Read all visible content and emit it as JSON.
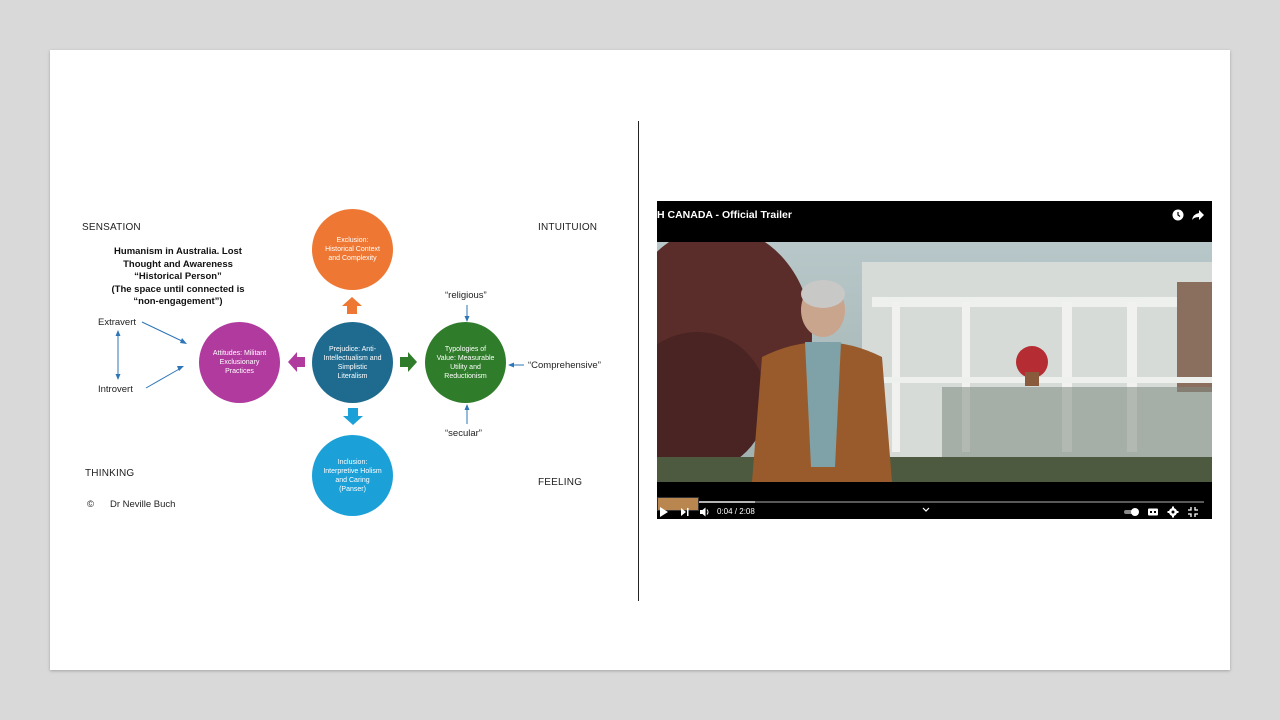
{
  "quadrants": {
    "sensation": "SENSATION",
    "intuition": "INTUITUION",
    "thinking": "THINKING",
    "feeling": "FEELING"
  },
  "caption": {
    "line1": "Humanism in Australia. Lost",
    "line2": "Thought and Awareness",
    "line3": "“Historical Person”",
    "line4": "(The space until connected is",
    "line5": "“non-engagement”)"
  },
  "axis": {
    "extravert": "Extravert",
    "introvert": "Introvert"
  },
  "annotations": {
    "religious": "“religious”",
    "secular": "“secular”",
    "comprehensive": "“Comprehensive”"
  },
  "copyright": {
    "symbol": "©",
    "author": "Dr Neville Buch"
  },
  "circles": {
    "top": {
      "text": "Exclusion: Historical Context and Complexity",
      "color": "#ee7733"
    },
    "left": {
      "text": "Attitudes: Militant Exclusionary Practices",
      "color": "#b03a9e"
    },
    "center": {
      "text": "Prejudice: Anti-Intellectualism and Simplistic Literalism",
      "color": "#1f6b8f"
    },
    "right": {
      "text": "Typologies of Value: Measurable Utility and Reductionism",
      "color": "#2f7d2a"
    },
    "bottom": {
      "text": "Inclusion: Interpretive Holism and Caring (Panser)",
      "color": "#1ba0d8"
    }
  },
  "video": {
    "title": "H CANADA - Official Trailer",
    "time": "0:04 / 2:08",
    "progress": 0.03,
    "buffered": 0.18,
    "icons": {
      "watch_later": "clock-icon",
      "share": "share-icon",
      "play": "play-icon",
      "next": "next-icon",
      "volume": "volume-icon",
      "chevron": "chevron-down-icon",
      "autoplay": "autoplay-toggle-icon",
      "captions": "captions-icon",
      "settings": "gear-icon",
      "fullscreen": "exit-fullscreen-icon"
    }
  }
}
